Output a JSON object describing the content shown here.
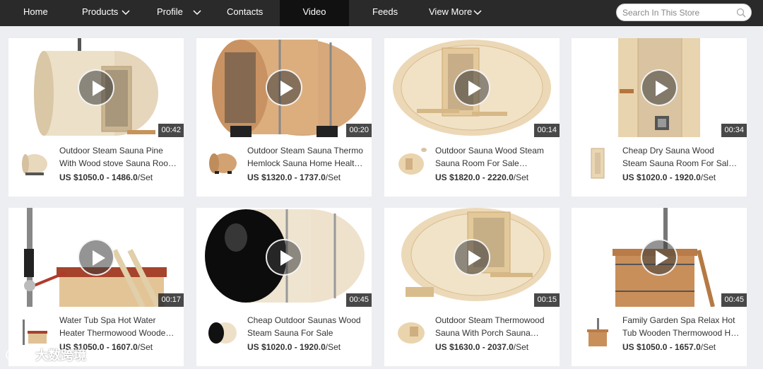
{
  "nav": {
    "items": [
      {
        "label": "Home",
        "dropdown": false,
        "active": false
      },
      {
        "label": "Products",
        "dropdown": true,
        "active": false
      },
      {
        "label": "Profile",
        "dropdown": true,
        "active": false
      },
      {
        "label": "Contacts",
        "dropdown": false,
        "active": false
      },
      {
        "label": "Video",
        "dropdown": false,
        "active": true
      },
      {
        "label": "Feeds",
        "dropdown": false,
        "active": false
      },
      {
        "label": "View More",
        "dropdown": true,
        "active": false
      }
    ],
    "search_placeholder": "Search In This Store",
    "search_icon": "search-icon"
  },
  "videos": [
    {
      "duration": "00:42",
      "title": "Outdoor Steam Sauna Pine With Wood stove Sauna Room For Sale",
      "currency": "US $",
      "range": "1050.0 - 1486.0",
      "unit": "/Set"
    },
    {
      "duration": "00:20",
      "title": "Outdoor Steam Sauna Thermo Hemlock Sauna Home Healthy Sauna",
      "currency": "US $",
      "range": "1320.0 - 1737.0",
      "unit": "/Set"
    },
    {
      "duration": "00:14",
      "title": "Outdoor Sauna Wood Steam Sauna Room For Sale Traditional",
      "currency": "US $",
      "range": "1820.0 - 2220.0",
      "unit": "/Set"
    },
    {
      "duration": "00:34",
      "title": "Cheap Dry Sauna Wood Steam Sauna Room For Sale Indoor",
      "currency": "US $",
      "range": "1020.0 - 1920.0",
      "unit": "/Set"
    },
    {
      "duration": "00:17",
      "title": "Water Tub Spa Hot Water Heater Thermowood Wooden Hot Tub",
      "currency": "US $",
      "range": "1050.0 - 1607.0",
      "unit": "/Set"
    },
    {
      "duration": "00:45",
      "title": "Cheap Outdoor Saunas Wood Steam Sauna For Sale",
      "currency": "US $",
      "range": "1020.0 - 1920.0",
      "unit": "/Set"
    },
    {
      "duration": "00:15",
      "title": "Outdoor Steam Thermowood Sauna With Porch Sauna House",
      "currency": "US $",
      "range": "1630.0 - 2037.0",
      "unit": "/Set"
    },
    {
      "duration": "00:45",
      "title": "Family Garden Spa Relax Hot Tub Wooden Thermowood Hot Tub",
      "currency": "US $",
      "range": "1050.0 - 1657.0",
      "unit": "/Set"
    }
  ],
  "watermark": "大数跨境",
  "colors": {
    "nav_bg": "#2a2a2a",
    "nav_active": "#111111",
    "page_bg": "#eceef1",
    "wood_light": "#e8d2ad",
    "wood_dark": "#c7935b"
  }
}
